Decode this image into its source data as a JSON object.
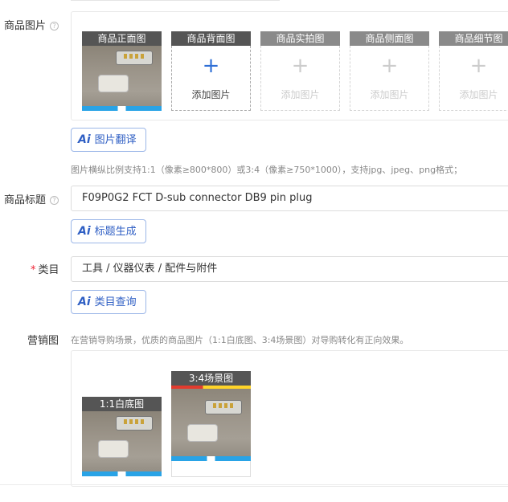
{
  "product_images": {
    "label": "商品图片",
    "slots": [
      {
        "title": "商品正面图",
        "filled": true
      },
      {
        "title": "商品背面图",
        "filled": false,
        "add_label": "添加图片",
        "active": true
      },
      {
        "title": "商品实拍图",
        "filled": false,
        "add_label": "添加图片",
        "active": false
      },
      {
        "title": "商品侧面图",
        "filled": false,
        "add_label": "添加图片",
        "active": false
      },
      {
        "title": "商品细节图",
        "filled": false,
        "add_label": "添加图片",
        "active": false
      }
    ],
    "translate_button": "图片翻译",
    "hint": "图片横纵比例支持1:1（像素≥800*800）或3:4（像素≥750*1000），支持jpg、jpeg、png格式；"
  },
  "title_field": {
    "label": "商品标题",
    "value": "F09P0G2 FCT D-sub connector DB9 pin plug",
    "generate_button": "标题生成"
  },
  "category_field": {
    "required_mark": "*",
    "label": "类目",
    "value": "工具 / 仪器仪表 / 配件与附件",
    "query_button": "类目查询"
  },
  "marketing": {
    "label": "营销图",
    "hint": "在营销导购场景，优质的商品图片（1:1白底图、3:4场景图）对导购转化有正向效果。",
    "slots": [
      {
        "title": "1:1白底图"
      },
      {
        "title": "3:4场景图"
      }
    ]
  },
  "icons": {
    "help": "question-circle-icon",
    "ai": "ai-icon",
    "plus": "plus-icon"
  },
  "colors": {
    "accent": "#2f5fc4",
    "plus_active": "#2f6fd6",
    "required": "#e22233"
  }
}
